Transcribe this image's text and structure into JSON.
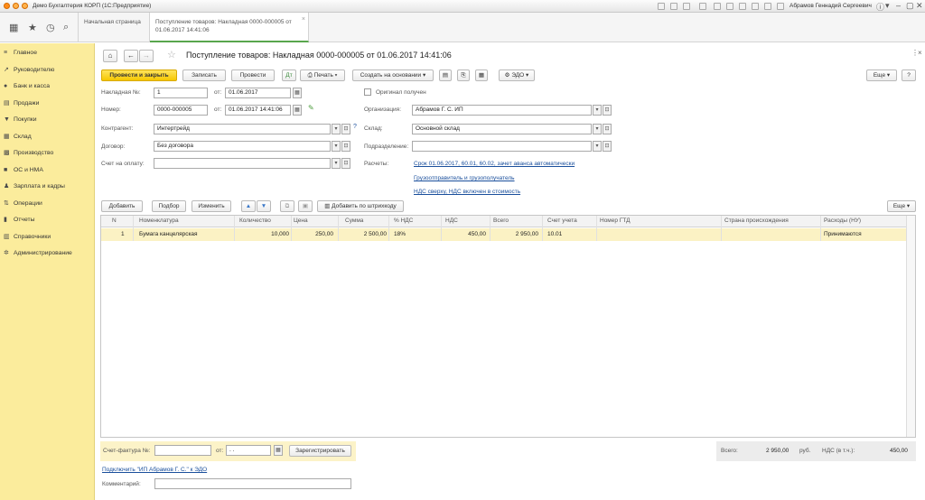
{
  "titlebar": {
    "app_title": "Демо Бухгалтерия КОРП  (1С:Предприятие)",
    "user": "Абрамов Геннадий Сергеевич"
  },
  "tabs": [
    {
      "label": "Начальная страница"
    },
    {
      "label": "Поступление товаров: Накладная 0000-000005 от 01.06.2017 14:41:06"
    }
  ],
  "sidebar": {
    "items": [
      {
        "label": "Главное",
        "icon": "≡"
      },
      {
        "label": "Руководителю",
        "icon": "↗"
      },
      {
        "label": "Банк и касса",
        "icon": "●"
      },
      {
        "label": "Продажи",
        "icon": "▤"
      },
      {
        "label": "Покупки",
        "icon": "▼"
      },
      {
        "label": "Склад",
        "icon": "▦"
      },
      {
        "label": "Производство",
        "icon": "▩"
      },
      {
        "label": "ОС и НМА",
        "icon": "■"
      },
      {
        "label": "Зарплата и кадры",
        "icon": "♟"
      },
      {
        "label": "Операции",
        "icon": "⇅"
      },
      {
        "label": "Отчеты",
        "icon": "▮"
      },
      {
        "label": "Справочники",
        "icon": "▥"
      },
      {
        "label": "Администрирование",
        "icon": "✲"
      }
    ]
  },
  "doc": {
    "title": "Поступление товаров: Накладная 0000-000005 от 01.06.2017 14:41:06",
    "toolbar": {
      "post_close": "Провести и закрыть",
      "save": "Записать",
      "post": "Провести",
      "print": "Печать",
      "create_based": "Создать на основании",
      "edo": "ЭДО",
      "more": "Еще",
      "help": "?"
    },
    "fields": {
      "invoice_no_label": "Накладная №:",
      "invoice_no": "1",
      "from_label": "от:",
      "invoice_date": "01.06.2017",
      "number_label": "Номер:",
      "number": "0000-000005",
      "number_date": "01.06.2017 14:41:06",
      "original_label": "Оригинал получен",
      "contractor_label": "Контрагент:",
      "contractor": "Интертрейд",
      "contract_label": "Договор:",
      "contract": "Без договора",
      "pay_invoice_label": "Счет на оплату:",
      "pay_invoice": "",
      "org_label": "Организация:",
      "org": "Абрамов Г. С. ИП",
      "warehouse_label": "Склад:",
      "warehouse": "Основной склад",
      "division_label": "Подразделение:",
      "division": "",
      "settlements_label": "Расчеты:",
      "settlements_link": "Срок 01.06.2017, 60.01, 60.02, зачет аванса автоматически",
      "shipper_link": "Грузоотправитель и грузополучатель",
      "vat_link": "НДС сверху, НДС включен в стоимость"
    },
    "table_toolbar": {
      "add": "Добавить",
      "pick": "Подбор",
      "change": "Изменить",
      "barcode": "Добавить по штрихкоду",
      "more": "Еще"
    },
    "table": {
      "columns": [
        "N",
        "Номенклатура",
        "Количество",
        "Цена",
        "Сумма",
        "% НДС",
        "НДС",
        "Всего",
        "Счет учета",
        "Номер ГТД",
        "Страна происхождения",
        "Расходы (НУ)"
      ],
      "rows": [
        [
          "1",
          "Бумага канцелярская",
          "10,000",
          "250,00",
          "2 500,00",
          "18%",
          "450,00",
          "2 950,00",
          "10.01",
          "",
          "",
          "Принимаются"
        ]
      ]
    },
    "footer": {
      "invoice_label": "Счет-фактура №:",
      "invoice_value": "",
      "from_label": "от:",
      "date_placeholder": " .  .",
      "register": "Зарегистрировать",
      "total_label": "Всего:",
      "total_value": "2 950,00",
      "currency": "руб.",
      "vat_label": "НДС (в т.ч.):",
      "vat_value": "450,00",
      "edo_link": "Подключить \"ИП Абрамов Г. С.\" к ЭДО",
      "comment_label": "Комментарий:",
      "comment": ""
    }
  }
}
